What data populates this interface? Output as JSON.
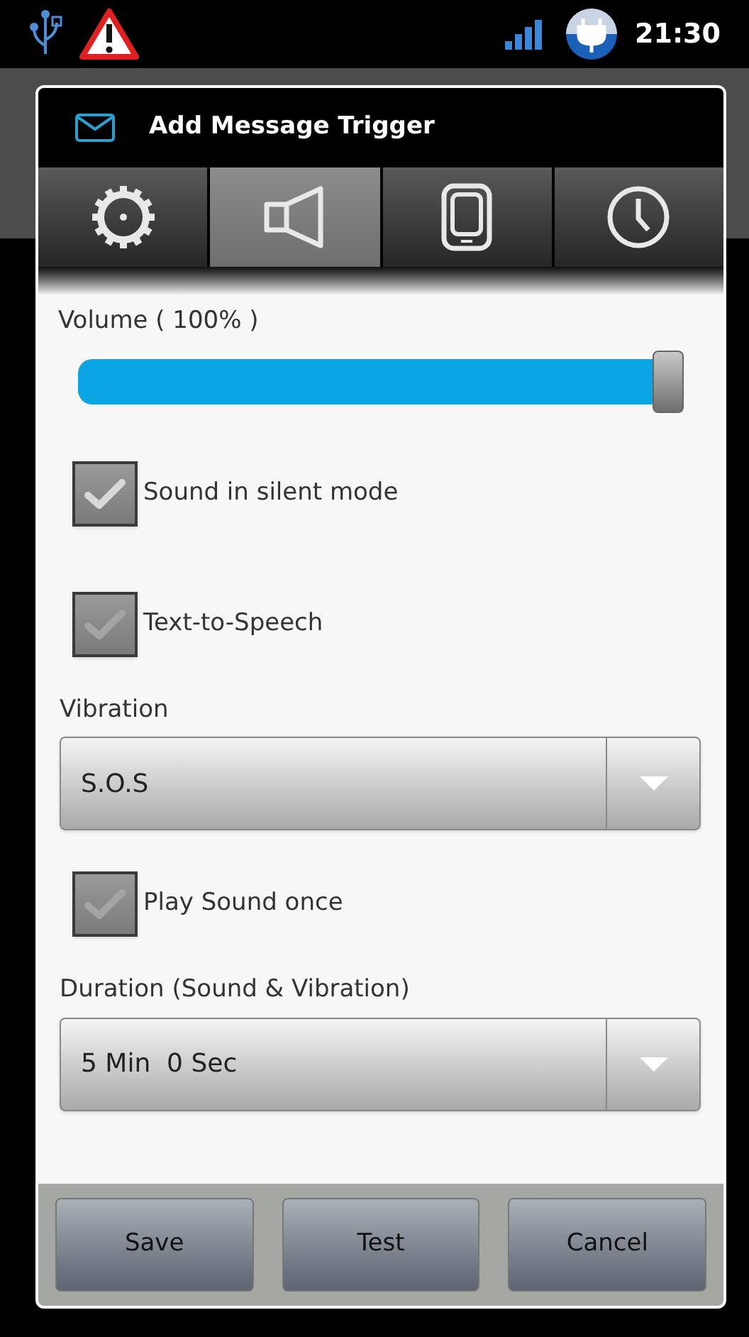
{
  "status_bar": {
    "time": "21:30"
  },
  "dialog": {
    "title": "Add Message Trigger",
    "tabs": [
      {
        "kind": "gear",
        "selected": false
      },
      {
        "kind": "speaker",
        "selected": true
      },
      {
        "kind": "phone",
        "selected": false
      },
      {
        "kind": "clock",
        "selected": false
      }
    ],
    "volume": {
      "label": "Volume ( 100% )",
      "level": 1.0
    },
    "items": [
      {
        "kind": "checkbox",
        "label": "Sound in silent mode",
        "checked": true
      },
      {
        "kind": "checkbox",
        "label": "Text-to-Speech",
        "checked": false
      },
      {
        "kind": "dropdown",
        "label": "Vibration",
        "value": "S.O.S"
      },
      {
        "kind": "checkbox",
        "label": "Play Sound once",
        "checked": false
      },
      {
        "kind": "dropdown",
        "label": "Duration (Sound & Vibration)",
        "value": "5 Min  0 Sec"
      }
    ],
    "buttons": [
      "Save",
      "Test",
      "Cancel"
    ]
  }
}
